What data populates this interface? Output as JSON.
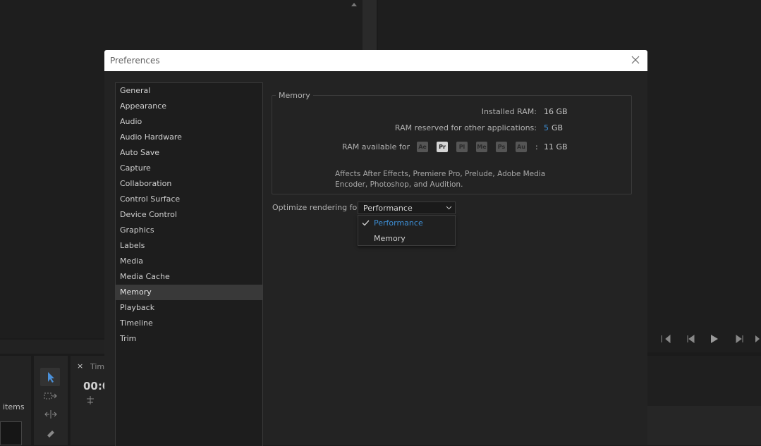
{
  "dialog": {
    "title": "Preferences"
  },
  "sidebar": {
    "items": [
      {
        "label": "General"
      },
      {
        "label": "Appearance"
      },
      {
        "label": "Audio"
      },
      {
        "label": "Audio Hardware"
      },
      {
        "label": "Auto Save"
      },
      {
        "label": "Capture"
      },
      {
        "label": "Collaboration"
      },
      {
        "label": "Control Surface"
      },
      {
        "label": "Device Control"
      },
      {
        "label": "Graphics"
      },
      {
        "label": "Labels"
      },
      {
        "label": "Media"
      },
      {
        "label": "Media Cache"
      },
      {
        "label": "Memory",
        "selected": true
      },
      {
        "label": "Playback"
      },
      {
        "label": "Timeline"
      },
      {
        "label": "Trim"
      }
    ]
  },
  "memory": {
    "group_title": "Memory",
    "installed_label": "Installed RAM:",
    "installed_value": "16 GB",
    "reserved_label": "RAM reserved for other applications:",
    "reserved_value": "5",
    "reserved_unit": "GB",
    "available_label": "RAM available for",
    "apps": [
      "Ae",
      "Pr",
      "Pl",
      "Me",
      "Ps",
      "Au"
    ],
    "available_sep": ":",
    "available_value": "11 GB",
    "note": "Affects After Effects, Premiere Pro, Prelude, Adobe Media Encoder, Photoshop, and Audition."
  },
  "optimize": {
    "label": "Optimize rendering for:",
    "selected": "Performance",
    "options": [
      "Performance",
      "Memory"
    ]
  },
  "background": {
    "items_text": "items",
    "timecode": "00:0",
    "tab_close": "×",
    "tab_label": "Tim"
  },
  "colors": {
    "accent": "#3d8fd6",
    "dialog_bg": "#232323",
    "selection": "#393939"
  }
}
